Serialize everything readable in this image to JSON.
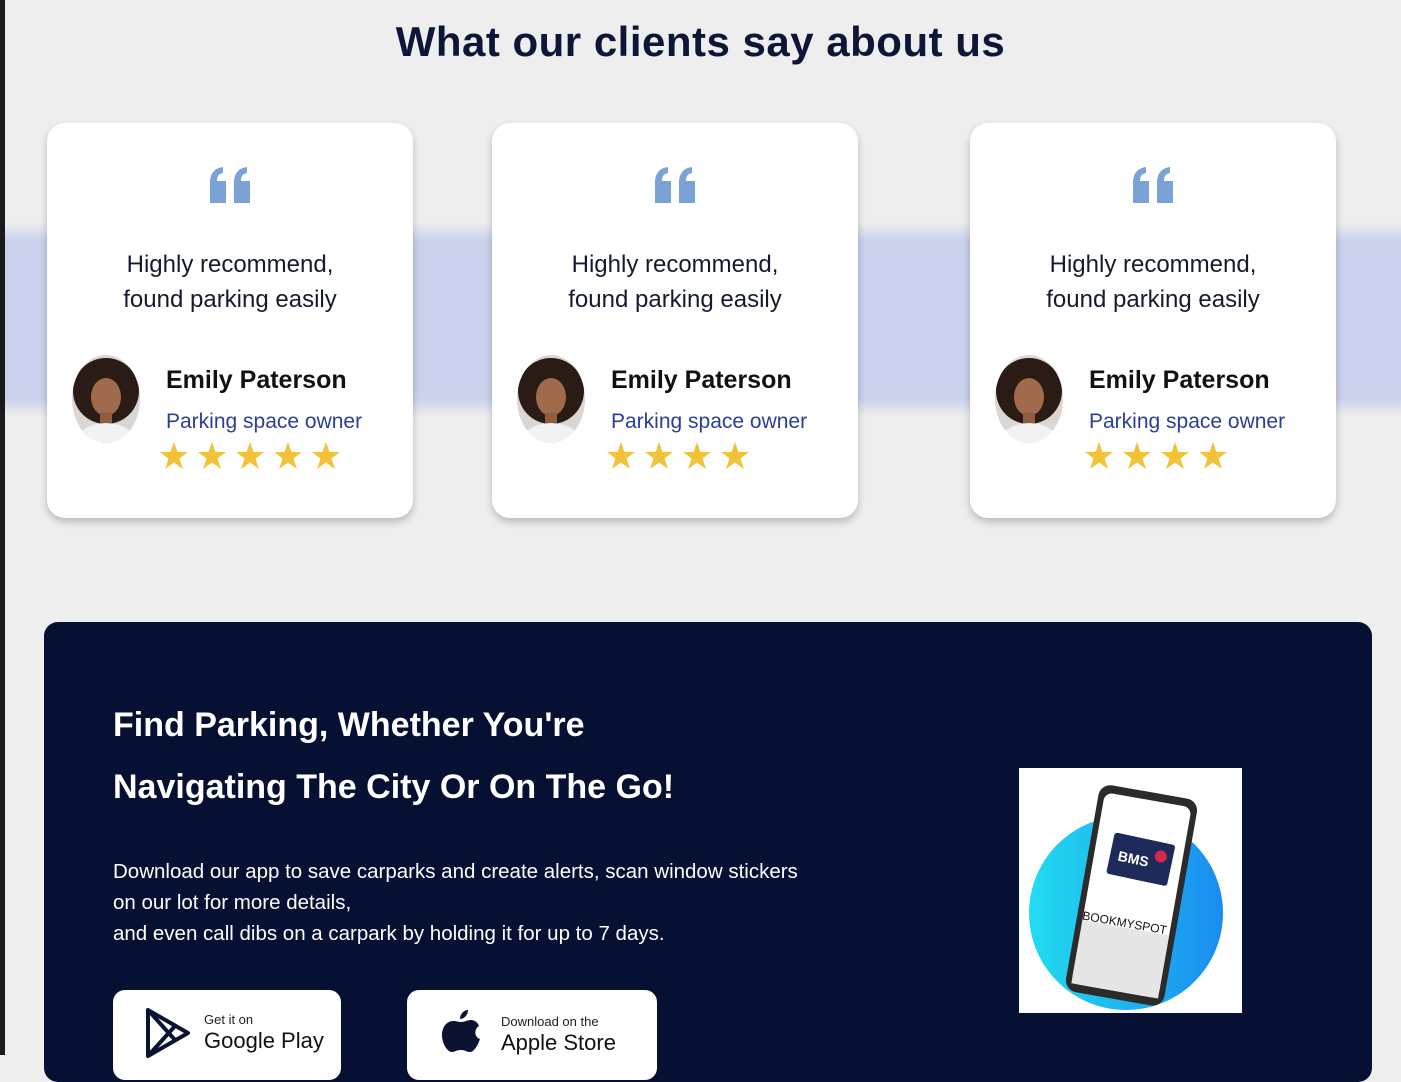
{
  "testimonials": {
    "title": "What our clients say about us",
    "cards": [
      {
        "text": "Highly recommend,\nfound parking easily",
        "name": "Emily Paterson",
        "role": "Parking space owner",
        "rating": 5
      },
      {
        "text": "Highly recommend,\nfound parking easily",
        "name": "Emily Paterson",
        "role": "Parking space owner",
        "rating": 4
      },
      {
        "text": "Highly recommend,\nfound parking easily",
        "name": "Emily Paterson",
        "role": "Parking space owner",
        "rating": 4
      }
    ]
  },
  "cta": {
    "title_line1": "Find Parking, Whether You're",
    "title_line2": "Navigating The City Or On The Go!",
    "description_line1": "Download our app to save carparks and create alerts, scan window stickers",
    "description_line2": "on our lot for more details,",
    "description_line3": "and even call dibs on a carpark by holding it for up to 7 days.",
    "google_play": {
      "small": "Get it on",
      "big": "Google Play",
      "icon": "google-play-icon"
    },
    "apple_store": {
      "small": "Download on the",
      "big": "Apple Store",
      "icon": "apple-icon"
    },
    "app_image": {
      "logo": "BMS",
      "brand": "BOOKMYSPOT"
    }
  },
  "colors": {
    "background": "#eeeeee",
    "band": "#c9d1ec",
    "quote": "#7aa2d4",
    "role": "#2b3f95",
    "star": "#f2c237",
    "cta_background": "#051033"
  }
}
